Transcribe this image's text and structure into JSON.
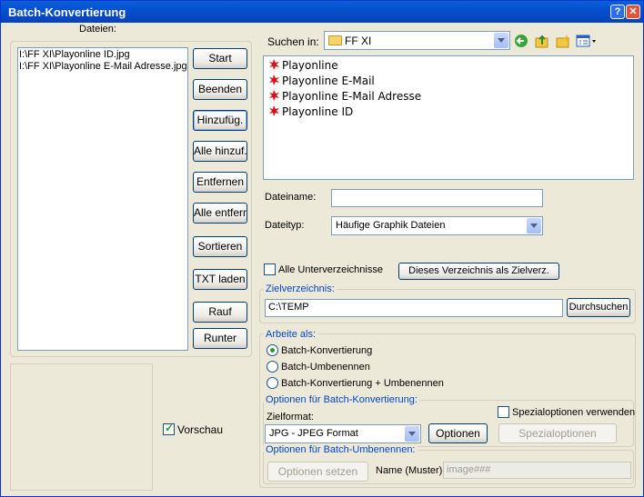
{
  "window": {
    "title": "Batch-Konvertierung"
  },
  "left": {
    "files_label": "Dateien:",
    "files": [
      "I:\\FF XI\\Playonline ID.jpg",
      "I:\\FF XI\\Playonline E-Mail Adresse.jpg"
    ],
    "buttons": {
      "start": "Start",
      "quit": "Beenden",
      "add": "Hinzufüg.",
      "add_all": "Alle hinzuf.",
      "remove": "Entfernen",
      "remove_all": "Alle entfern.",
      "sort": "Sortieren",
      "load_txt": "TXT laden",
      "up": "Rauf",
      "down": "Runter"
    },
    "preview_label": "Vorschau",
    "preview_checked": true
  },
  "browser": {
    "look_in_label": "Suchen in:",
    "look_in_value": "FF XI",
    "items": [
      "Playonline",
      "Playonline E-Mail",
      "Playonline E-Mail Adresse",
      "Playonline ID"
    ],
    "filename_label": "Dateiname:",
    "filename_value": "",
    "filetype_label": "Dateityp:",
    "filetype_value": "Häufige Graphik Dateien"
  },
  "subdirs": {
    "label": "Alle Unterverzeichnisse",
    "checked": false
  },
  "set_target_button": "Dieses Verzeichnis als Zielverz.",
  "target": {
    "legend": "Zielverzeichnis:",
    "value": "C:\\TEMP",
    "browse_button": "Durchsuchen"
  },
  "work_as": {
    "legend": "Arbeite als:",
    "options": [
      "Batch-Konvertierung",
      "Batch-Umbenennen",
      "Batch-Konvertierung + Umbenennen"
    ],
    "selected": 0
  },
  "convert_options": {
    "legend": "Optionen für Batch-Konvertierung:",
    "format_label": "Zielformat:",
    "format_value": "JPG - JPEG Format",
    "options_button": "Optionen",
    "special_label": "Spezialoptionen verwenden",
    "special_checked": false,
    "special_button": "Spezialoptionen"
  },
  "rename_options": {
    "legend": "Optionen für Batch-Umbenennen:",
    "set_button": "Optionen setzen",
    "pattern_label": "Name (Muster):",
    "pattern_value": "image###"
  },
  "colors": {
    "title_bar": "#0550d0",
    "window_bg": "#ece9d8",
    "legend_text": "#0046d5",
    "check_green": "#21a121"
  }
}
